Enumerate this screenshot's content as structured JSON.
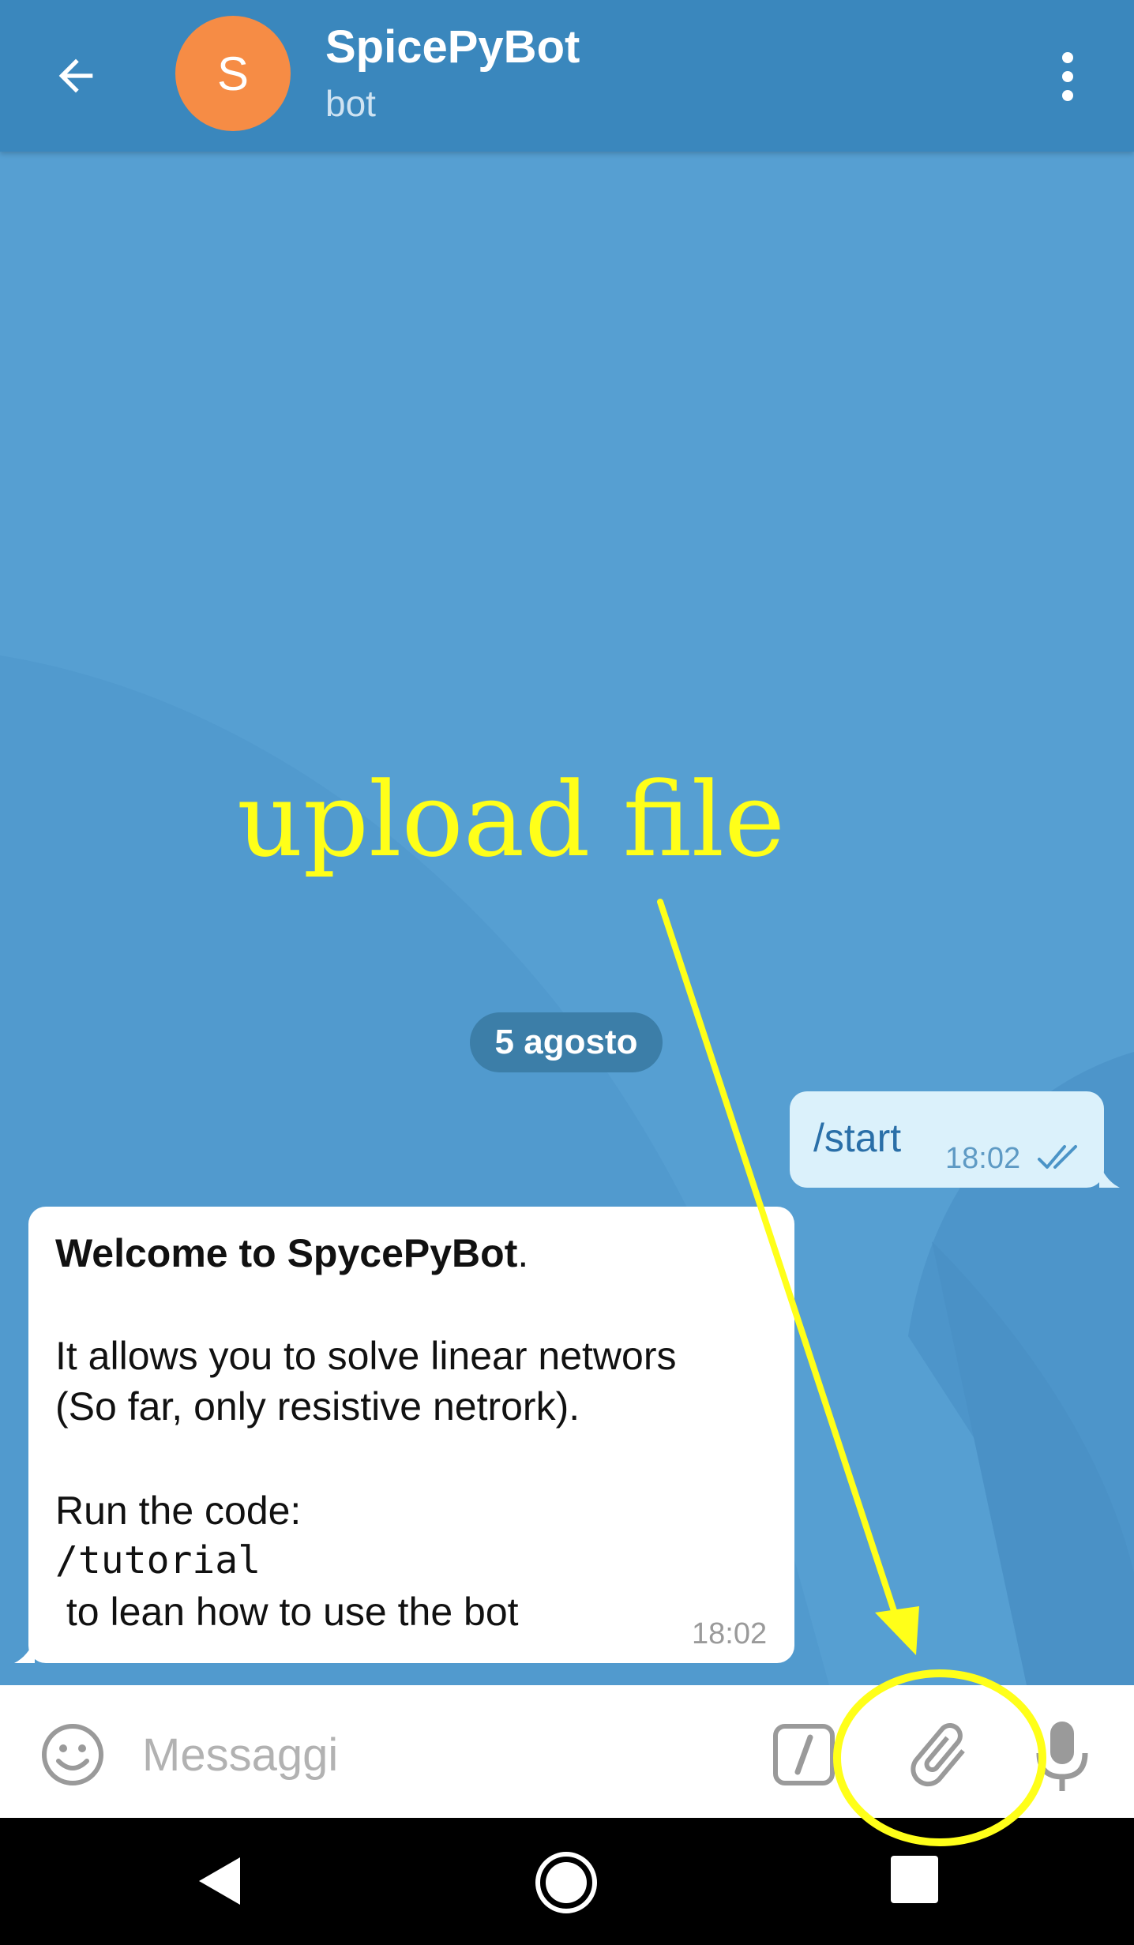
{
  "colors": {
    "header": "#3a87bd",
    "chat_background": "#569fd2",
    "avatar": "#f68c45",
    "annotation": "#ffff19",
    "outgoing_bubble": "#dbf1fb"
  },
  "header": {
    "back_icon": "arrow-left",
    "avatar_letter": "S",
    "title": "SpicePyBot",
    "subtitle": "bot",
    "menu_icon": "more-vertical"
  },
  "annotation": {
    "text": "upload file",
    "target": "attach-button"
  },
  "chat": {
    "date_label": "5 agosto",
    "messages": [
      {
        "direction": "outgoing",
        "text": "/start",
        "time": "18:02",
        "status_icon": "double-check"
      },
      {
        "direction": "incoming",
        "lines": [
          {
            "text": "Welcome to SpycePyBot",
            "suffix": "."
          },
          {
            "text": "It allows you to solve linear networs"
          },
          {
            "text": "(So far, only resistive netrork)."
          },
          {
            "text": "Run the code:"
          },
          {
            "text": "/tutorial"
          },
          {
            "text": " to lean how to use the bot"
          }
        ],
        "time": "18:02"
      }
    ]
  },
  "input_bar": {
    "emoji_icon": "smiley",
    "placeholder": "Messaggi",
    "value": "",
    "command_icon": "slash-command",
    "attach_icon": "paperclip",
    "mic_icon": "microphone"
  },
  "nav_bar": {
    "back_icon": "triangle-back",
    "home_icon": "circle-home",
    "recents_icon": "square-recents"
  }
}
